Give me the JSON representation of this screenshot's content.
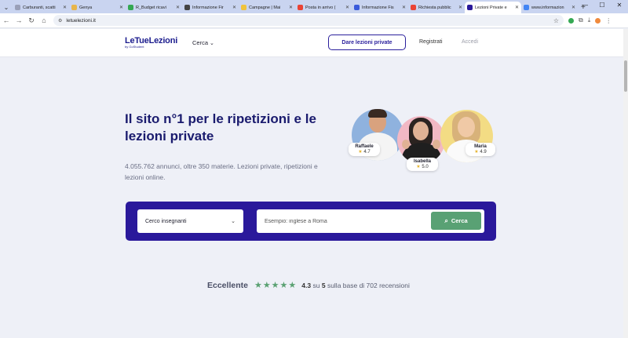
{
  "browser": {
    "tabs": [
      {
        "label": "Carburanti, scatti",
        "color": "#9aa0b8",
        "active": false
      },
      {
        "label": "Genya",
        "color": "#e8b54a",
        "active": false
      },
      {
        "label": "R_Budget ricavi",
        "color": "#34a853",
        "active": false
      },
      {
        "label": "Informazione Fir",
        "color": "#444444",
        "active": false
      },
      {
        "label": "Campagne | Mai",
        "color": "#f0c33c",
        "active": false
      },
      {
        "label": "Posta in arrivo (",
        "color": "#ea4335",
        "active": false
      },
      {
        "label": "Informazione Fis",
        "color": "#3b5bdb",
        "active": false
      },
      {
        "label": "Richiesta pubblic",
        "color": "#ea4335",
        "active": false
      },
      {
        "label": "Lezioni Private e",
        "color": "#2a199b",
        "active": true
      },
      {
        "label": "www.informazion",
        "color": "#4285f4",
        "active": false
      }
    ],
    "url": "letuelezioni.it"
  },
  "header": {
    "logo": "LeTueLezioni",
    "logo_sub": "by GoStudent",
    "search_menu": "Cerca",
    "cta": "Dare lezioni private",
    "register": "Registrati",
    "login": "Accedi"
  },
  "hero": {
    "title": "Il sito n°1 per le ripetizioni e le lezioni private",
    "subtitle": "4.055.762 annunci, oltre 350 materie. Lezioni private, ripetizioni e lezioni online."
  },
  "tutors": [
    {
      "name": "Raffaele",
      "rating": "4.7"
    },
    {
      "name": "Isabella",
      "rating": "5.0"
    },
    {
      "name": "Maria",
      "rating": "4.9"
    }
  ],
  "search": {
    "select_value": "Cerco insegnanti",
    "placeholder": "Esempio: inglese a Roma",
    "button": "Cerca"
  },
  "rating": {
    "label": "Eccellente",
    "score": "4.3",
    "on": "su",
    "max": "5",
    "text": "sulla base di 702 recensioni"
  }
}
